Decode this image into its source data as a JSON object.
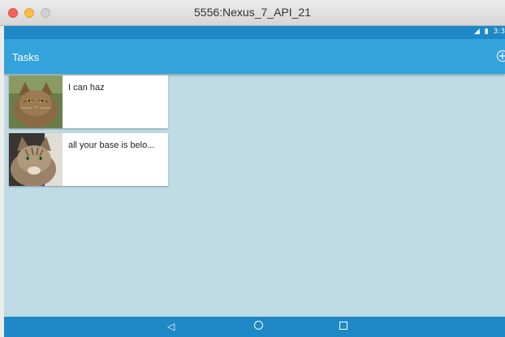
{
  "window": {
    "title": "5556:Nexus_7_API_21"
  },
  "status_bar": {
    "signal_icon": "signal-icon",
    "battery_icon": "battery-icon",
    "time": "3:3"
  },
  "app_bar": {
    "title": "Tasks",
    "add_icon": "add-circle-icon"
  },
  "tasks": [
    {
      "text": "I can haz",
      "image": "cat-photo"
    },
    {
      "text": "all your base is belo...",
      "image": "cat-photo"
    }
  ],
  "nav_bar": {
    "back_icon": "back-triangle-icon",
    "home_icon": "home-circle-icon",
    "recent_icon": "recent-square-icon"
  },
  "colors": {
    "status_bar": "#1f88c7",
    "app_bar": "#34a3db",
    "background": "#bfdbe6"
  }
}
